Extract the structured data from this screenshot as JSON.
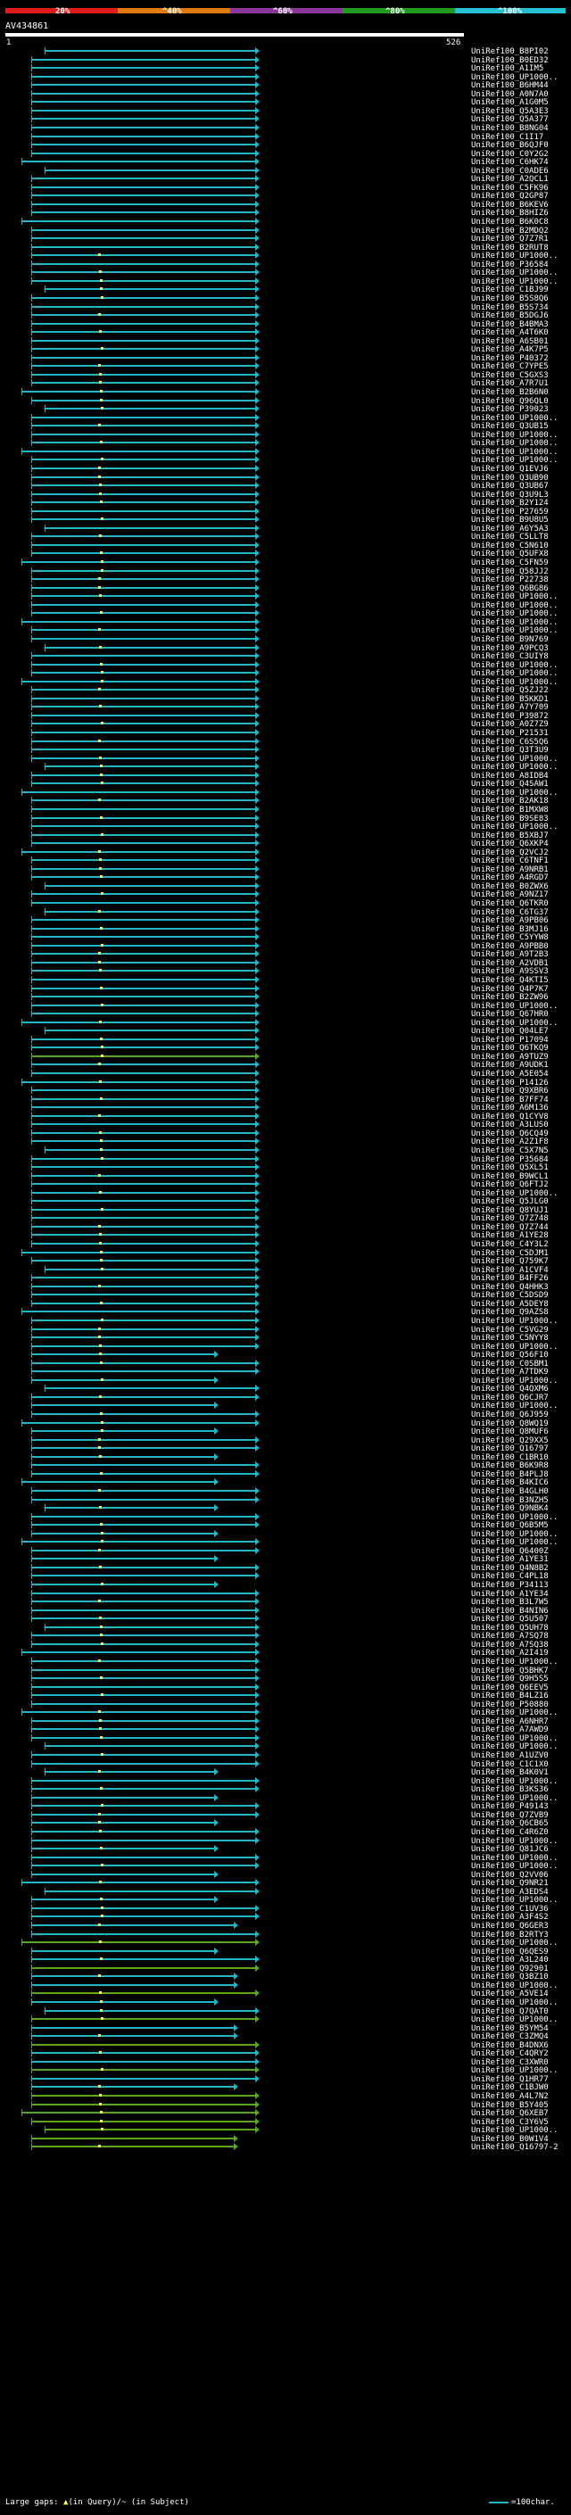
{
  "colors": {
    "background": "#000000",
    "match_line": "#22b5c6",
    "match_line_green": "#5aa71f",
    "gap_mark": "#ffff66",
    "scale_20": "#e01b1b",
    "scale_40": "#e07a10",
    "scale_60": "#8a3a9a",
    "scale_80": "#1f9a1f",
    "scale_100": "#22c0d0"
  },
  "scale": {
    "p20": "20%",
    "p40": "^40%",
    "p60": "^60%",
    "p80": "^80%",
    "p100": "^100%"
  },
  "query": {
    "name": "AV434861",
    "start": "1",
    "end": "526"
  },
  "hits": [
    "UniRef100_B8PI02",
    "UniRef100_B0ED32",
    "UniRef100_A1IM5",
    "UniRef100_UP1000..",
    "UniRef100_B6HM44",
    "UniRef100_A0N7A0",
    "UniRef100_A1G0M5",
    "UniRef100_Q5A3E3",
    "UniRef100_Q5A377",
    "UniRef100_B8NG04",
    "UniRef100_C1I17",
    "UniRef100_B6QJF0",
    "UniRef100_C0Y2G2",
    "UniRef100_C6HK74",
    "UniRef100_C0ADE6",
    "UniRef100_A2QCL1",
    "UniRef100_C5FK96",
    "UniRef100_Q2GP87",
    "UniRef100_B6KEV6",
    "UniRef100_B8HIZ6",
    "UniRef100_B6K0C8",
    "UniRef100_B2MDQ2",
    "UniRef100_Q7Z7R1",
    "UniRef100_B2RUT8",
    "UniRef100_UP1000..",
    "UniRef100_P36584",
    "UniRef100_UP1000..",
    "UniRef100_UP1000..",
    "UniRef100_C1BJ99",
    "UniRef100_B5S8Q6",
    "UniRef100_B5S734",
    "UniRef100_B5DGJ6",
    "UniRef100_B4BMA3",
    "UniRef100_A4T6K0",
    "UniRef100_A6SB01",
    "UniRef100_A4K7P5",
    "UniRef100_P40372",
    "UniRef100_C7YPE5",
    "UniRef100_C5GXS3",
    "UniRef100_A7R7U1",
    "UniRef100_B2B6N0",
    "UniRef100_Q96QL0",
    "UniRef100_P39023",
    "UniRef100_UP1000..",
    "UniRef100_Q3UB15",
    "UniRef100_UP1000..",
    "UniRef100_UP1000..",
    "UniRef100_UP1000..",
    "UniRef100_UP1000..",
    "UniRef100_Q1EVJ6",
    "UniRef100_Q3UB90",
    "UniRef100_Q3UB67",
    "UniRef100_Q3U9L3",
    "UniRef100_B2Y124",
    "UniRef100_P27659",
    "UniRef100_B9U8U5",
    "UniRef100_A6Y5A3",
    "UniRef100_C5LLT8",
    "UniRef100_C5N610",
    "UniRef100_Q5UFX8",
    "UniRef100_C5FN59",
    "UniRef100_Q58JJ2",
    "UniRef100_P22738",
    "UniRef100_Q6BG86",
    "UniRef100_UP1000..",
    "UniRef100_UP1000..",
    "UniRef100_UP1000..",
    "UniRef100_UP1000..",
    "UniRef100_UP1000..",
    "UniRef100_B9N769",
    "UniRef100_A9PCQ3",
    "UniRef100_C3UIY8",
    "UniRef100_UP1000..",
    "UniRef100_UP1000..",
    "UniRef100_UP1000..",
    "UniRef100_Q5ZJ22",
    "UniRef100_B5KKD1",
    "UniRef100_A7Y709",
    "UniRef100_P39872",
    "UniRef100_A0Z7Z9",
    "UniRef100_P21531",
    "UniRef100_C6S5Q6",
    "UniRef100_Q3T3U9",
    "UniRef100_UP1000..",
    "UniRef100_UP1000..",
    "UniRef100_A8IDB4",
    "UniRef100_Q4SAW1",
    "UniRef100_UP1000..",
    "UniRef100_B2AK18",
    "UniRef100_B1MXW8",
    "UniRef100_B9SE83",
    "UniRef100_UP1000..",
    "UniRef100_B5XBJ7",
    "UniRef100_Q6XKP4",
    "UniRef100_Q2VCJ2",
    "UniRef100_C6TNF1",
    "UniRef100_A9NRB1",
    "UniRef100_A4RGD7",
    "UniRef100_B0ZWX6",
    "UniRef100_A9NZ17",
    "UniRef100_Q6TKR0",
    "UniRef100_C6TG37",
    "UniRef100_A9PB06",
    "UniRef100_B3MJ16",
    "UniRef100_C5YYW8",
    "UniRef100_A9PBB0",
    "UniRef100_A9T2B3",
    "UniRef100_A2VDB1",
    "UniRef100_A9SSV3",
    "UniRef100_Q4KTI5",
    "UniRef100_Q4P7K7",
    "UniRef100_B2ZW96",
    "UniRef100_UP1000..",
    "UniRef100_Q67HR0",
    "UniRef100_UP1000..",
    "UniRef100_Q04LE7",
    "UniRef100_P17094",
    "UniRef100_Q6TKQ9",
    "UniRef100_A9TUZ9",
    "UniRef100_A9UDK1",
    "UniRef100_A5E054",
    "UniRef100_P14126",
    "UniRef100_Q9XBR6",
    "UniRef100_B7FF74",
    "UniRef100_A6M136",
    "UniRef100_Q1CYV8",
    "UniRef100_A3LUS0",
    "UniRef100_Q6CQ49",
    "UniRef100_A2Z1F8",
    "UniRef100_C5X7N5",
    "UniRef100_P35684",
    "UniRef100_Q5XL51",
    "UniRef100_B9WCL1",
    "UniRef100_Q6FTJ2",
    "UniRef100_UP1000..",
    "UniRef100_Q5JLG0",
    "UniRef100_Q8YUJ1",
    "UniRef100_Q7Z748",
    "UniRef100_Q7Z744",
    "UniRef100_A1YE28",
    "UniRef100_C4Y3L2",
    "UniRef100_C5DJM1",
    "UniRef100_Q759K7",
    "UniRef100_A1CVF4",
    "UniRef100_B4FF26",
    "UniRef100_Q4HHK3",
    "UniRef100_C5DSD9",
    "UniRef100_A5DEY8",
    "UniRef100_Q9AZS8",
    "UniRef100_UP1000..",
    "UniRef100_C5VG29",
    "UniRef100_C5NYY8",
    "UniRef100_UP1000..",
    "UniRef100_Q56F10",
    "UniRef100_C0SBM1",
    "UniRef100_A7TDK9",
    "UniRef100_UP1000..",
    "UniRef100_Q4QXM6",
    "UniRef100_Q6CJR7",
    "UniRef100_UP1000..",
    "UniRef100_Q6J959",
    "UniRef100_Q8WQ19",
    "UniRef100_Q8MUF6",
    "UniRef100_Q29XX5",
    "UniRef100_Q16797",
    "UniRef100_C1BR10",
    "UniRef100_B6K9R8",
    "UniRef100_B4PLJ8",
    "UniRef100_B4KIC6",
    "UniRef100_B4GLH0",
    "UniRef100_B3NZH5",
    "UniRef100_Q9NBK4",
    "UniRef100_UP1000..",
    "UniRef100_Q6B5M5",
    "UniRef100_UP1000..",
    "UniRef100_UP1000..",
    "UniRef100_Q6400Z",
    "UniRef100_A1YE31",
    "UniRef100_Q4N8B2",
    "UniRef100_C4PL18",
    "UniRef100_P34113",
    "UniRef100_A1YE34",
    "UniRef100_B3L7W5",
    "UniRef100_B4NIN6",
    "UniRef100_Q5U507",
    "UniRef100_Q5UH78",
    "UniRef100_A7SQ78",
    "UniRef100_A7SQ38",
    "UniRef100_A2I419",
    "UniRef100_UP1000..",
    "UniRef100_Q5BHK7",
    "UniRef100_Q9H5S5",
    "UniRef100_Q6EEV5",
    "UniRef100_B4LZ16",
    "UniRef100_P50880",
    "UniRef100_UP1000..",
    "UniRef100_A6NHR7",
    "UniRef100_A7AWD9",
    "UniRef100_UP1000..",
    "UniRef100_UP1000..",
    "UniRef100_A1UZV0",
    "UniRef100_C1C1X0",
    "UniRef100_B4K0V1",
    "UniRef100_UP1000..",
    "UniRef100_B3KS36",
    "UniRef100_UP1000..",
    "UniRef100_P49143",
    "UniRef100_Q7ZVB9",
    "UniRef100_Q6CB65",
    "UniRef100_C4R6Z0",
    "UniRef100_UP1000..",
    "UniRef100_Q81JC6",
    "UniRef100_UP1000..",
    "UniRef100_UP1000..",
    "UniRef100_Q2VV06",
    "UniRef100_Q9NR21",
    "UniRef100_A3EDS4",
    "UniRef100_UP1000..",
    "UniRef100_C1UV36",
    "UniRef100_A3F4S2",
    "UniRef100_Q6GER3",
    "UniRef100_B2RTY3",
    "UniRef100_UP1000..",
    "UniRef100_Q6QES9",
    "UniRef100_A3L240",
    "UniRef100_Q92901",
    "UniRef100_Q3BZ10",
    "UniRef100_UP1000..",
    "UniRef100_A5VE14",
    "UniRef100_UP1000..",
    "UniRef100_Q7QAT0",
    "UniRef100_UP1000..",
    "UniRef100_B5YM54",
    "UniRef100_C3ZMQ4",
    "UniRef100_B4DNX6",
    "UniRef100_C4QRY2",
    "UniRef100_C3XWR0",
    "UniRef100_UP1000..",
    "UniRef100_Q1HR77",
    "UniRef100_C1BJW0",
    "UniRef100_A4L7N2",
    "UniRef100_B5Y405",
    "UniRef100_Q6XEB7",
    "UniRef100_C3Y6V5",
    "UniRef100_UP1000..",
    "UniRef100_B0W1V4",
    "UniRef100_Q16797-2"
  ],
  "legend": {
    "large_gaps": "Large gaps:",
    "in_query": "(in Query)",
    "slash": "/",
    "in_subject": "~ (in Subject)",
    "scale_note": "=100char."
  }
}
